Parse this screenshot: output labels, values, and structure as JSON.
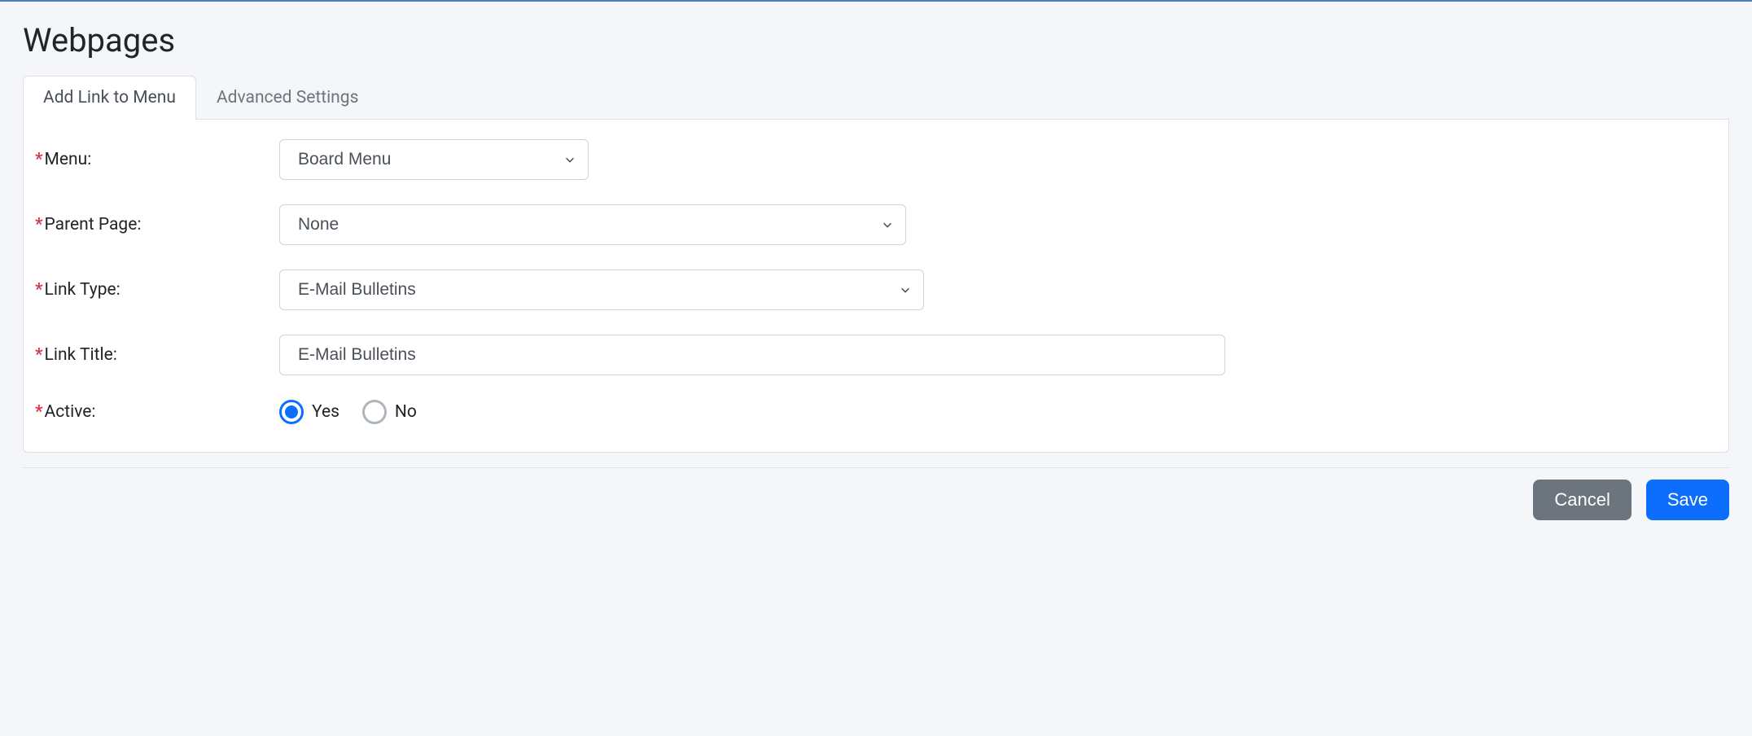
{
  "page_title": "Webpages",
  "tabs": {
    "add_link": "Add Link to Menu",
    "advanced": "Advanced Settings"
  },
  "form": {
    "menu": {
      "label": "Menu:",
      "value": "Board Menu"
    },
    "parent_page": {
      "label": "Parent Page:",
      "value": "None"
    },
    "link_type": {
      "label": "Link Type:",
      "value": "E-Mail Bulletins"
    },
    "link_title": {
      "label": "Link Title:",
      "value": "E-Mail Bulletins"
    },
    "active": {
      "label": "Active:",
      "yes": "Yes",
      "no": "No",
      "value": "yes"
    }
  },
  "actions": {
    "cancel": "Cancel",
    "save": "Save"
  }
}
